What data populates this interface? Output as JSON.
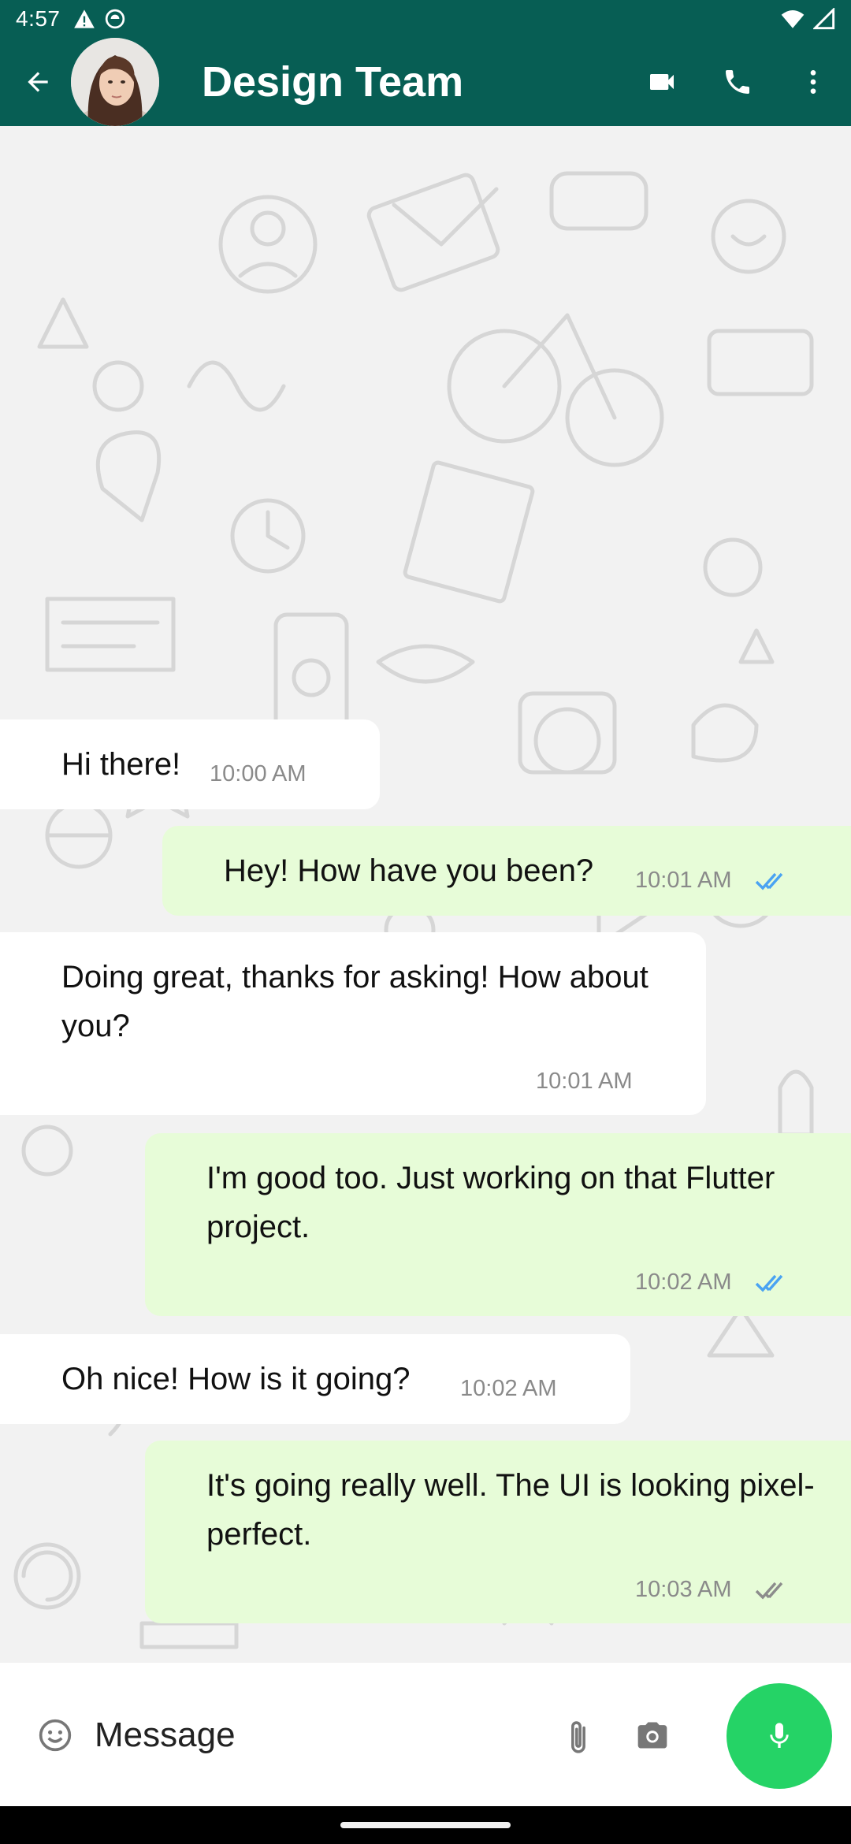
{
  "status_bar": {
    "time": "4:57"
  },
  "header": {
    "title": "Design Team",
    "icons": [
      "back-arrow-icon",
      "video-call-icon",
      "phone-icon",
      "more-vert-icon"
    ]
  },
  "messages": [
    {
      "direction": "incoming",
      "text": "Hi there!",
      "time": "10:00 AM"
    },
    {
      "direction": "outgoing",
      "text": "Hey! How have you been?",
      "time": "10:01 AM",
      "ticks": "read"
    },
    {
      "direction": "incoming",
      "text": "Doing great, thanks for asking! How about you?",
      "time": "10:01 AM"
    },
    {
      "direction": "outgoing",
      "text": "I'm good too. Just working on that Flutter project.",
      "time": "10:02 AM",
      "ticks": "read"
    },
    {
      "direction": "incoming",
      "text": "Oh nice! How is it going?",
      "time": "10:02 AM"
    },
    {
      "direction": "outgoing",
      "text": "It's going really well. The UI is looking pixel-perfect.",
      "time": "10:03 AM",
      "ticks": "delivered"
    }
  ],
  "composer": {
    "placeholder": "Message",
    "value": ""
  },
  "colors": {
    "header": "#075e54",
    "outgoing_bubble": "#e7fcd8",
    "incoming_bubble": "#ffffff",
    "read_ticks": "#4aa3f2",
    "delivered_ticks": "#8c8c8c",
    "mic_button": "#25d366"
  }
}
